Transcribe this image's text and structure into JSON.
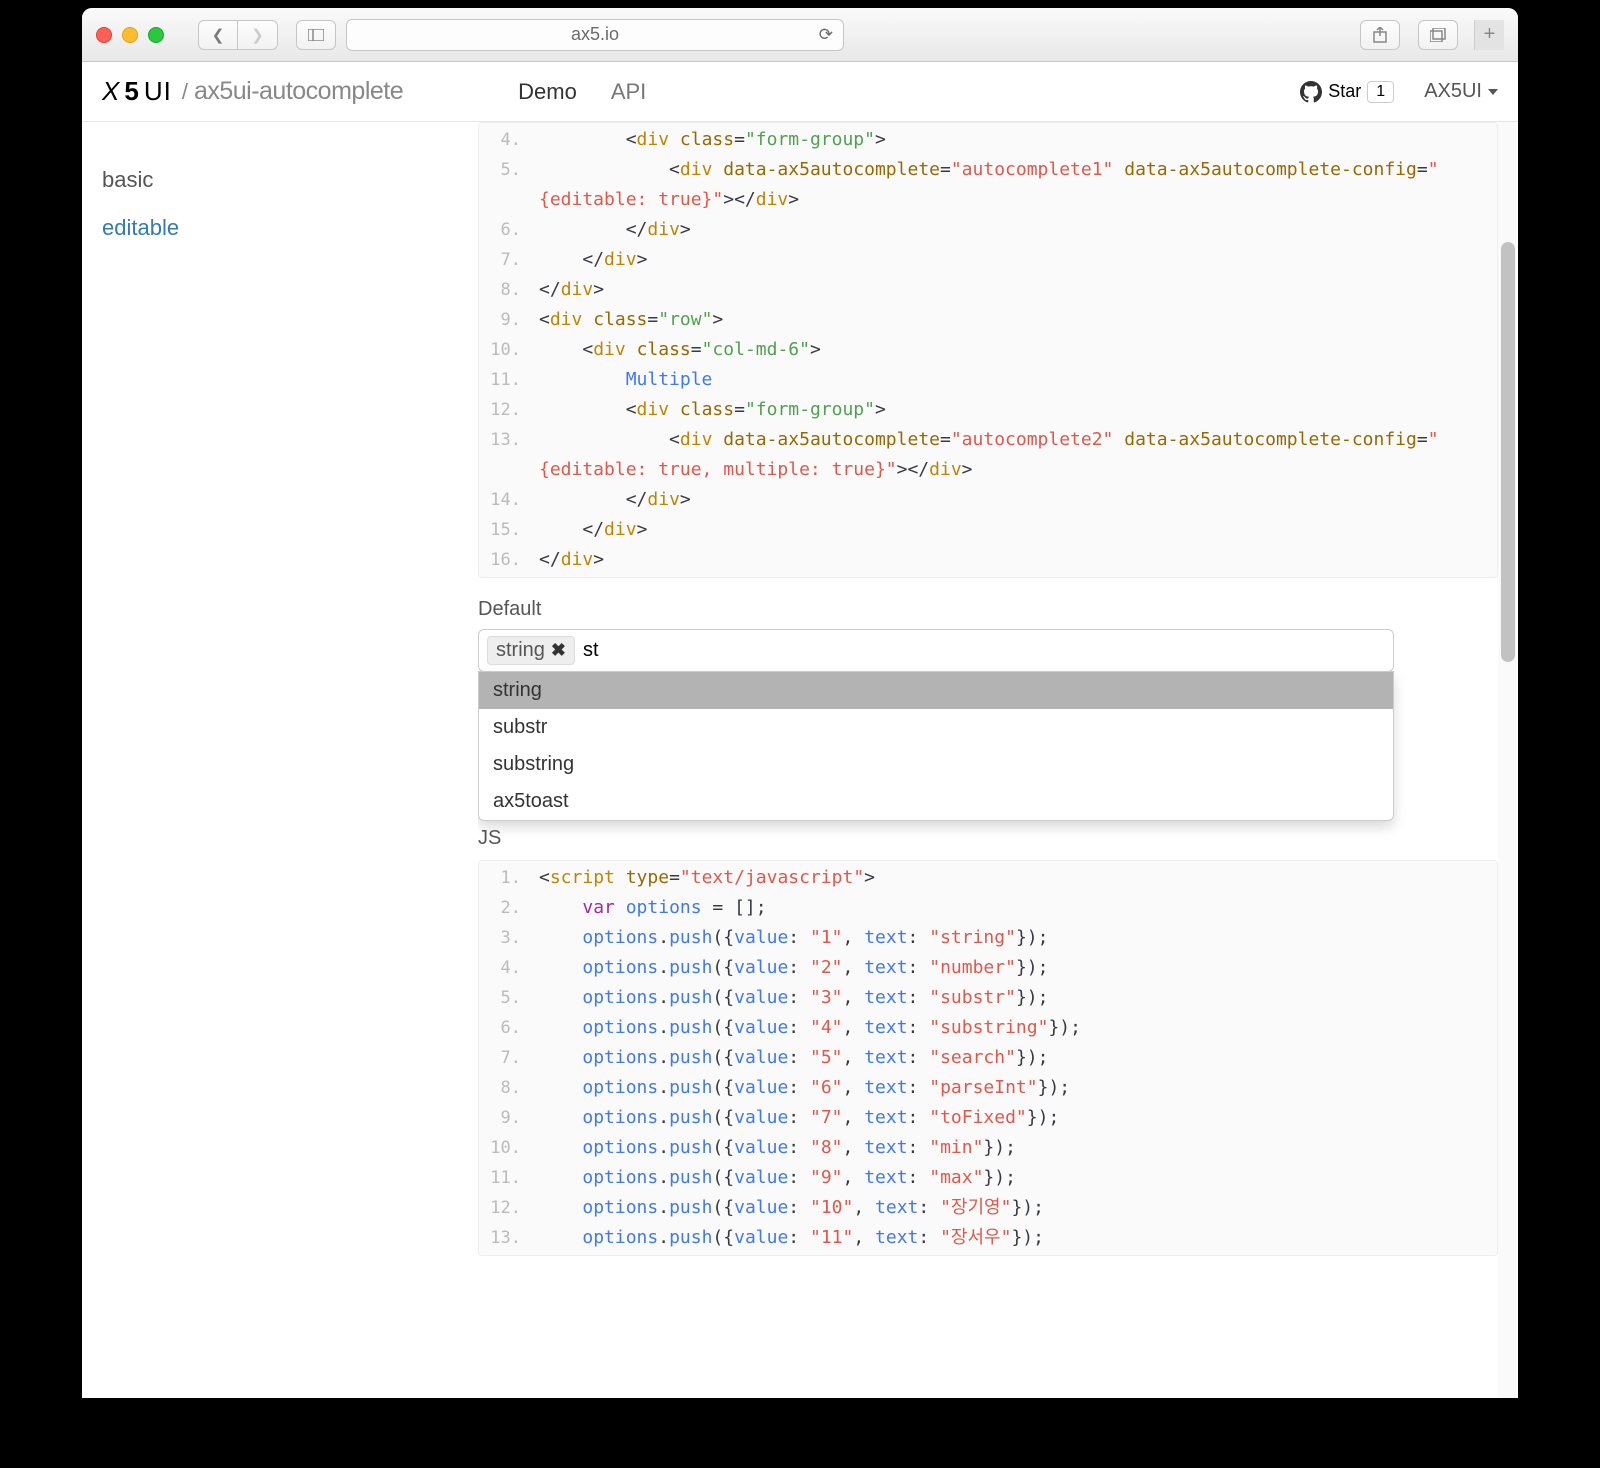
{
  "browser": {
    "url": "ax5.io"
  },
  "nav": {
    "brand": "X5UI",
    "sub": "ax5ui-autocomplete",
    "demo": "Demo",
    "api": "API",
    "star_label": "Star",
    "star_count": "1",
    "user": "AX5UI"
  },
  "sidebar": {
    "items": [
      {
        "label": "basic"
      },
      {
        "label": "editable"
      }
    ]
  },
  "demo": {
    "default_label": "Default",
    "chip_label": "string",
    "input_value": "st",
    "options": [
      "string",
      "substr",
      "substring",
      "ax5toast"
    ],
    "js_label": "JS"
  },
  "code_html": {
    "lines": [
      {
        "n": "4.",
        "indent": 8,
        "html": "<span class='t-plain'>&lt;</span><span class='t-tag'>div</span> <span class='t-attr'>class</span><span class='t-plain'>=</span><span class='t-str'>\"form-group\"</span><span class='t-plain'>&gt;</span>"
      },
      {
        "n": "5.",
        "indent": 12,
        "html": "<span class='t-plain'>&lt;</span><span class='t-tag'>div</span> <span class='t-attr'>data-ax5autocomplete</span><span class='t-plain'>=</span><span class='t-str2'>\"autocomplete1\"</span> <span class='t-attr'>data-ax5autocomplete-config</span><span class='t-plain'>=</span><span class='t-str2'>\"</span>"
      },
      {
        "n": "",
        "indent": 0,
        "html": "<span class='t-str2'>{editable: true}\"</span><span class='t-plain'>&gt;&lt;/</span><span class='t-tag'>div</span><span class='t-plain'>&gt;</span>",
        "continuation": true
      },
      {
        "n": "6.",
        "indent": 8,
        "html": "<span class='t-plain'>&lt;/</span><span class='t-tag'>div</span><span class='t-plain'>&gt;</span>"
      },
      {
        "n": "7.",
        "indent": 4,
        "html": "<span class='t-plain'>&lt;/</span><span class='t-tag'>div</span><span class='t-plain'>&gt;</span>"
      },
      {
        "n": "8.",
        "indent": 0,
        "html": "<span class='t-plain'>&lt;/</span><span class='t-tag'>div</span><span class='t-plain'>&gt;</span>"
      },
      {
        "n": "9.",
        "indent": 0,
        "html": "<span class='t-plain'>&lt;</span><span class='t-tag'>div</span> <span class='t-attr'>class</span><span class='t-plain'>=</span><span class='t-str'>\"row\"</span><span class='t-plain'>&gt;</span>"
      },
      {
        "n": "10.",
        "indent": 4,
        "html": "<span class='t-plain'>&lt;</span><span class='t-tag'>div</span> <span class='t-attr'>class</span><span class='t-plain'>=</span><span class='t-str'>\"col-md-6\"</span><span class='t-plain'>&gt;</span>"
      },
      {
        "n": "11.",
        "indent": 8,
        "html": "<span class='t-id'>Multiple</span>"
      },
      {
        "n": "12.",
        "indent": 8,
        "html": "<span class='t-plain'>&lt;</span><span class='t-tag'>div</span> <span class='t-attr'>class</span><span class='t-plain'>=</span><span class='t-str'>\"form-group\"</span><span class='t-plain'>&gt;</span>"
      },
      {
        "n": "13.",
        "indent": 12,
        "html": "<span class='t-plain'>&lt;</span><span class='t-tag'>div</span> <span class='t-attr'>data-ax5autocomplete</span><span class='t-plain'>=</span><span class='t-str2'>\"autocomplete2\"</span> <span class='t-attr'>data-ax5autocomplete-config</span><span class='t-plain'>=</span><span class='t-str2'>\"</span>"
      },
      {
        "n": "",
        "indent": 0,
        "html": "<span class='t-str2'>{editable: true, multiple: true}\"</span><span class='t-plain'>&gt;&lt;/</span><span class='t-tag'>div</span><span class='t-plain'>&gt;</span>",
        "continuation": true
      },
      {
        "n": "14.",
        "indent": 8,
        "html": "<span class='t-plain'>&lt;/</span><span class='t-tag'>div</span><span class='t-plain'>&gt;</span>"
      },
      {
        "n": "15.",
        "indent": 4,
        "html": "<span class='t-plain'>&lt;/</span><span class='t-tag'>div</span><span class='t-plain'>&gt;</span>"
      },
      {
        "n": "16.",
        "indent": 0,
        "html": "<span class='t-plain'>&lt;/</span><span class='t-tag'>div</span><span class='t-plain'>&gt;</span>"
      }
    ]
  },
  "code_js": {
    "lines": [
      {
        "n": "1.",
        "indent": 0,
        "html": "<span class='t-plain'>&lt;</span><span class='t-tag'>script</span> <span class='t-attr'>type</span><span class='t-plain'>=</span><span class='t-str2'>\"text/javascript\"</span><span class='t-plain'>&gt;</span>"
      },
      {
        "n": "2.",
        "indent": 4,
        "html": "<span class='t-kw'>var</span> <span class='t-id'>options</span> <span class='t-plain'>= [];</span>"
      },
      {
        "n": "3.",
        "indent": 4,
        "html": "<span class='t-id'>options</span><span class='t-plain'>.</span><span class='t-id'>push</span><span class='t-plain'>({</span><span class='t-id'>value</span><span class='t-plain'>: </span><span class='t-str2'>\"1\"</span><span class='t-plain'>, </span><span class='t-id'>text</span><span class='t-plain'>: </span><span class='t-str2'>\"string\"</span><span class='t-plain'>});</span>"
      },
      {
        "n": "4.",
        "indent": 4,
        "html": "<span class='t-id'>options</span><span class='t-plain'>.</span><span class='t-id'>push</span><span class='t-plain'>({</span><span class='t-id'>value</span><span class='t-plain'>: </span><span class='t-str2'>\"2\"</span><span class='t-plain'>, </span><span class='t-id'>text</span><span class='t-plain'>: </span><span class='t-str2'>\"number\"</span><span class='t-plain'>});</span>"
      },
      {
        "n": "5.",
        "indent": 4,
        "html": "<span class='t-id'>options</span><span class='t-plain'>.</span><span class='t-id'>push</span><span class='t-plain'>({</span><span class='t-id'>value</span><span class='t-plain'>: </span><span class='t-str2'>\"3\"</span><span class='t-plain'>, </span><span class='t-id'>text</span><span class='t-plain'>: </span><span class='t-str2'>\"substr\"</span><span class='t-plain'>});</span>"
      },
      {
        "n": "6.",
        "indent": 4,
        "html": "<span class='t-id'>options</span><span class='t-plain'>.</span><span class='t-id'>push</span><span class='t-plain'>({</span><span class='t-id'>value</span><span class='t-plain'>: </span><span class='t-str2'>\"4\"</span><span class='t-plain'>, </span><span class='t-id'>text</span><span class='t-plain'>: </span><span class='t-str2'>\"substring\"</span><span class='t-plain'>});</span>"
      },
      {
        "n": "7.",
        "indent": 4,
        "html": "<span class='t-id'>options</span><span class='t-plain'>.</span><span class='t-id'>push</span><span class='t-plain'>({</span><span class='t-id'>value</span><span class='t-plain'>: </span><span class='t-str2'>\"5\"</span><span class='t-plain'>, </span><span class='t-id'>text</span><span class='t-plain'>: </span><span class='t-str2'>\"search\"</span><span class='t-plain'>});</span>"
      },
      {
        "n": "8.",
        "indent": 4,
        "html": "<span class='t-id'>options</span><span class='t-plain'>.</span><span class='t-id'>push</span><span class='t-plain'>({</span><span class='t-id'>value</span><span class='t-plain'>: </span><span class='t-str2'>\"6\"</span><span class='t-plain'>, </span><span class='t-id'>text</span><span class='t-plain'>: </span><span class='t-str2'>\"parseInt\"</span><span class='t-plain'>});</span>"
      },
      {
        "n": "9.",
        "indent": 4,
        "html": "<span class='t-id'>options</span><span class='t-plain'>.</span><span class='t-id'>push</span><span class='t-plain'>({</span><span class='t-id'>value</span><span class='t-plain'>: </span><span class='t-str2'>\"7\"</span><span class='t-plain'>, </span><span class='t-id'>text</span><span class='t-plain'>: </span><span class='t-str2'>\"toFixed\"</span><span class='t-plain'>});</span>"
      },
      {
        "n": "10.",
        "indent": 4,
        "html": "<span class='t-id'>options</span><span class='t-plain'>.</span><span class='t-id'>push</span><span class='t-plain'>({</span><span class='t-id'>value</span><span class='t-plain'>: </span><span class='t-str2'>\"8\"</span><span class='t-plain'>, </span><span class='t-id'>text</span><span class='t-plain'>: </span><span class='t-str2'>\"min\"</span><span class='t-plain'>});</span>"
      },
      {
        "n": "11.",
        "indent": 4,
        "html": "<span class='t-id'>options</span><span class='t-plain'>.</span><span class='t-id'>push</span><span class='t-plain'>({</span><span class='t-id'>value</span><span class='t-plain'>: </span><span class='t-str2'>\"9\"</span><span class='t-plain'>, </span><span class='t-id'>text</span><span class='t-plain'>: </span><span class='t-str2'>\"max\"</span><span class='t-plain'>});</span>"
      },
      {
        "n": "12.",
        "indent": 4,
        "html": "<span class='t-id'>options</span><span class='t-plain'>.</span><span class='t-id'>push</span><span class='t-plain'>({</span><span class='t-id'>value</span><span class='t-plain'>: </span><span class='t-str2'>\"10\"</span><span class='t-plain'>, </span><span class='t-id'>text</span><span class='t-plain'>: </span><span class='t-str2'>\"장기영\"</span><span class='t-plain'>});</span>"
      },
      {
        "n": "13.",
        "indent": 4,
        "html": "<span class='t-id'>options</span><span class='t-plain'>.</span><span class='t-id'>push</span><span class='t-plain'>({</span><span class='t-id'>value</span><span class='t-plain'>: </span><span class='t-str2'>\"11\"</span><span class='t-plain'>, </span><span class='t-id'>text</span><span class='t-plain'>: </span><span class='t-str2'>\"장서우\"</span><span class='t-plain'>});</span>"
      }
    ]
  }
}
